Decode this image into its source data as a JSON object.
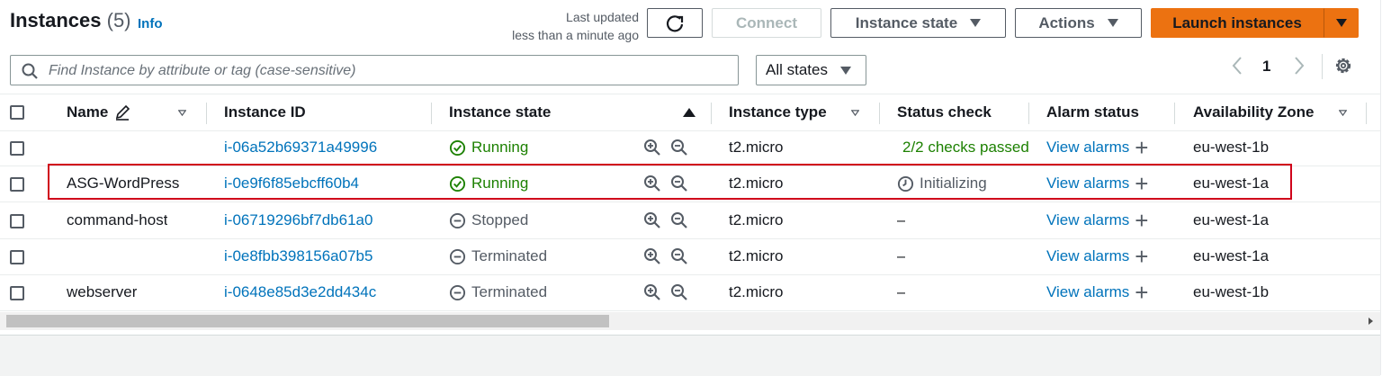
{
  "header": {
    "title": "Instances",
    "count": "(5)",
    "info": "Info",
    "last_updated_line1": "Last updated",
    "last_updated_line2": "less than a minute ago",
    "buttons": {
      "connect": "Connect",
      "instance_state": "Instance state",
      "actions": "Actions",
      "launch": "Launch instances"
    }
  },
  "search": {
    "placeholder": "Find Instance by attribute or tag (case-sensitive)",
    "state_filter": "All states"
  },
  "pagination": {
    "current_page": "1"
  },
  "table": {
    "columns": [
      "Name",
      "Instance ID",
      "Instance state",
      "Instance type",
      "Status check",
      "Alarm status",
      "Availability Zone"
    ],
    "rows": [
      {
        "name": "",
        "id": "i-06a52b69371a49996",
        "state": "Running",
        "type": "t2.micro",
        "status": "2/2 checks passed",
        "alarm": "View alarms",
        "az": "eu-west-1b"
      },
      {
        "name": "ASG-WordPress",
        "id": "i-0e9f6f85ebcff60b4",
        "state": "Running",
        "type": "t2.micro",
        "status": "Initializing",
        "alarm": "View alarms",
        "az": "eu-west-1a"
      },
      {
        "name": "command-host",
        "id": "i-06719296bf7db61a0",
        "state": "Stopped",
        "type": "t2.micro",
        "status": "–",
        "alarm": "View alarms",
        "az": "eu-west-1a"
      },
      {
        "name": "",
        "id": "i-0e8fbb398156a07b5",
        "state": "Terminated",
        "type": "t2.micro",
        "status": "–",
        "alarm": "View alarms",
        "az": "eu-west-1a"
      },
      {
        "name": "webserver",
        "id": "i-0648e85d3e2dd434c",
        "state": "Terminated",
        "type": "t2.micro",
        "status": "–",
        "alarm": "View alarms",
        "az": "eu-west-1b"
      }
    ]
  },
  "colors": {
    "primary": "#ec7211",
    "link": "#0073bb",
    "success": "#1d8102",
    "highlight": "#d0021b"
  }
}
